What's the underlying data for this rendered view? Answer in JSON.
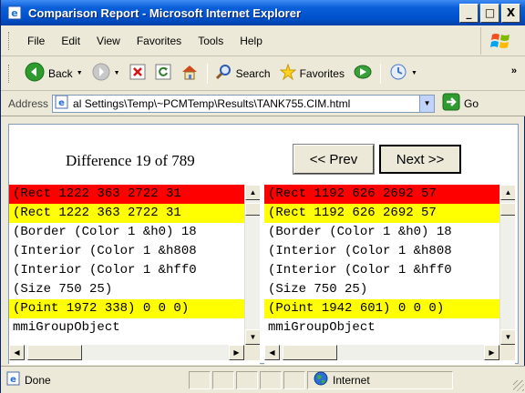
{
  "window": {
    "title": "Comparison Report - Microsoft Internet Explorer",
    "minimize_glyph": "_",
    "maximize_glyph": "□",
    "close_glyph": "X"
  },
  "menu": {
    "items": [
      "File",
      "Edit",
      "View",
      "Favorites",
      "Tools",
      "Help"
    ]
  },
  "toolbar": {
    "back_label": "Back",
    "search_label": "Search",
    "favorites_label": "Favorites",
    "overflow_glyph": "»"
  },
  "address": {
    "label": "Address",
    "value": "al Settings\\Temp\\~PCMTemp\\Results\\TANK755.CIM.html",
    "go_label": "Go"
  },
  "report": {
    "difference_text": "Difference 19 of 789",
    "prev_label": "<< Prev",
    "next_label": "Next >>",
    "left_lines": [
      {
        "text": "  (Rect 1222 363 2722 31",
        "highlight": "red"
      },
      {
        "text": "  (Rect 1222 363 2722 31",
        "highlight": "yellow"
      },
      {
        "text": "(Border (Color 1 &h0) 18",
        "highlight": "none"
      },
      {
        "text": "(Interior (Color 1 &h808",
        "highlight": "none"
      },
      {
        "text": "(Interior (Color 1 &hff0",
        "highlight": "none"
      },
      {
        "text": "(Size 750 25)",
        "highlight": "none"
      },
      {
        "text": "(Point 1972 338) 0 0 0)",
        "highlight": "yellow"
      },
      {
        "text": "mmiGroupObject",
        "highlight": "none"
      }
    ],
    "right_lines": [
      {
        "text": "  (Rect 1192 626 2692 57",
        "highlight": "red"
      },
      {
        "text": "  (Rect 1192 626 2692 57",
        "highlight": "yellow"
      },
      {
        "text": "(Border (Color 1 &h0) 18",
        "highlight": "none"
      },
      {
        "text": "(Interior (Color 1 &h808",
        "highlight": "none"
      },
      {
        "text": "(Interior (Color 1 &hff0",
        "highlight": "none"
      },
      {
        "text": "(Size 750 25)",
        "highlight": "none"
      },
      {
        "text": "(Point 1942 601) 0 0 0)",
        "highlight": "yellow"
      },
      {
        "text": "mmiGroupObject",
        "highlight": "none"
      }
    ]
  },
  "status": {
    "text": "Done",
    "zone": "Internet"
  },
  "colors": {
    "title_bar": "#0052cc",
    "highlight_red": "#ff0000",
    "highlight_yellow": "#ffff00",
    "chrome": "#ece9d8"
  },
  "icons": [
    "ie-page-icon",
    "windows-flag-icon",
    "back-arrow-icon",
    "forward-arrow-icon",
    "stop-icon",
    "refresh-icon",
    "home-icon",
    "search-icon",
    "favorites-star-icon",
    "media-icon",
    "history-icon",
    "go-arrow-icon",
    "globe-icon"
  ]
}
